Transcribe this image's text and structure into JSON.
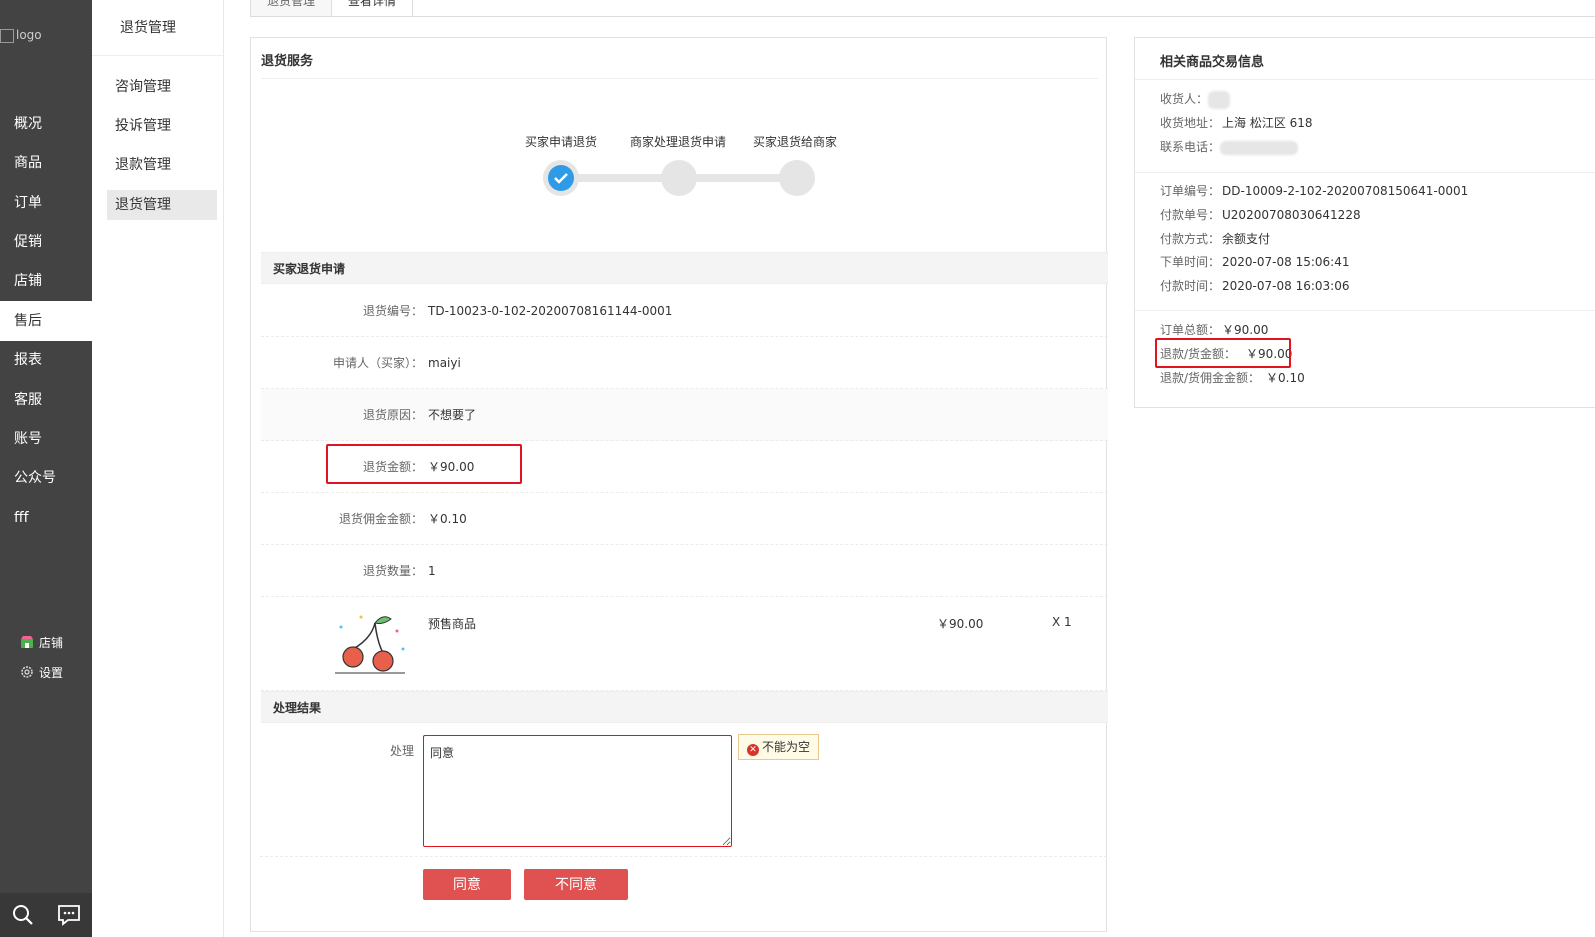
{
  "sidebar": {
    "logo_alt": "logo",
    "items": [
      {
        "label": "概况"
      },
      {
        "label": "商品"
      },
      {
        "label": "订单"
      },
      {
        "label": "促销"
      },
      {
        "label": "店铺"
      },
      {
        "label": "售后"
      },
      {
        "label": "报表"
      },
      {
        "label": "客服"
      },
      {
        "label": "账号"
      },
      {
        "label": "公众号"
      },
      {
        "label": "fff"
      }
    ],
    "active_index": 5,
    "bottom_links": [
      {
        "label": "店铺",
        "icon": "shop-icon"
      },
      {
        "label": "设置",
        "icon": "gear-icon"
      }
    ],
    "tools": [
      "search-icon",
      "chat-icon"
    ]
  },
  "subnav": {
    "title": "退货管理",
    "items": [
      {
        "label": "咨询管理"
      },
      {
        "label": "投诉管理"
      },
      {
        "label": "退款管理"
      },
      {
        "label": "退货管理"
      }
    ],
    "active_index": 3
  },
  "tabs": [
    {
      "label": "退货管理"
    },
    {
      "label": "查看详情"
    }
  ],
  "service": {
    "title": "退货服务",
    "steps": [
      {
        "label": "买家申请退货",
        "done": true
      },
      {
        "label": "商家处理退货申请",
        "done": false
      },
      {
        "label": "买家退货给商家",
        "done": false
      }
    ]
  },
  "apply": {
    "title": "买家退货申请",
    "rows": [
      {
        "label": "退货编号：",
        "value": "TD-10023-0-102-20200708161144-0001"
      },
      {
        "label": "申请人（买家）：",
        "value": "maiyi"
      },
      {
        "label": "退货原因：",
        "value": "不想要了"
      },
      {
        "label": "退货金额：",
        "value": "￥90.00"
      },
      {
        "label": "退货佣金金额：",
        "value": "￥0.10"
      },
      {
        "label": "退货数量：",
        "value": "1"
      }
    ],
    "goods": {
      "name": "预售商品",
      "price": "￥90.00",
      "qty": "X 1"
    }
  },
  "result": {
    "title": "处理结果",
    "label": "处理",
    "textarea_value": "同意",
    "error": "不能为空",
    "agree_button": "同意",
    "disagree_button": "不同意"
  },
  "trade": {
    "title": "相关商品交易信息",
    "receiver_label": "收货人：",
    "address_label": "收货地址：",
    "address_value": "上海 松江区 618",
    "phone_label": "联系电话：",
    "order": [
      {
        "label": "订单编号：",
        "value": "DD-10009-2-102-20200708150641-0001"
      },
      {
        "label": "付款单号：",
        "value": "U20200708030641228"
      },
      {
        "label": "付款方式：",
        "value": "余额支付"
      },
      {
        "label": "下单时间：",
        "value": "2020-07-08 15:06:41"
      },
      {
        "label": "付款时间：",
        "value": "2020-07-08 16:03:06"
      }
    ],
    "amounts": [
      {
        "label": "订单总额：",
        "value": "￥90.00"
      },
      {
        "label": "退款/货金额：",
        "value": "￥90.00"
      },
      {
        "label": "退款/货佣金金额：",
        "value": "￥0.10"
      }
    ]
  },
  "colors": {
    "accent": "#e05252",
    "highlight": "#e0141e",
    "step_done": "#2f9be6",
    "sidebar": "#434343"
  }
}
